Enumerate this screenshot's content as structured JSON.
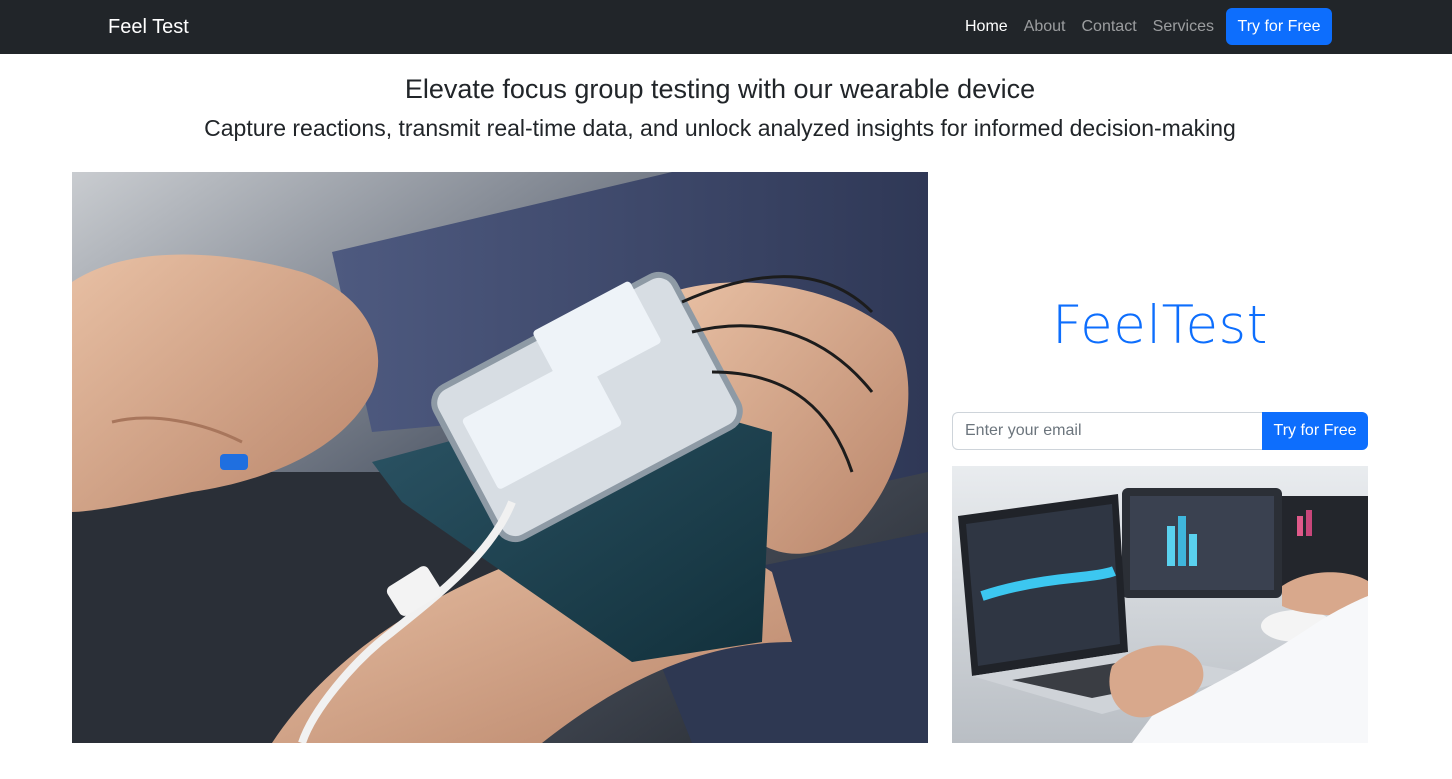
{
  "navbar": {
    "brand": "Feel Test",
    "links": [
      {
        "label": "Home",
        "active": true
      },
      {
        "label": "About",
        "active": false
      },
      {
        "label": "Contact",
        "active": false
      },
      {
        "label": "Services",
        "active": false
      }
    ],
    "cta_label": "Try for Free"
  },
  "hero": {
    "headline": "Elevate focus group testing with our wearable device",
    "subheadline": "Capture reactions, transmit real-time data, and unlock analyzed insights for informed decision-making"
  },
  "sidebar": {
    "logo_text": "FeelTest",
    "email_placeholder": "Enter your email",
    "submit_label": "Try for Free"
  },
  "colors": {
    "navbar_bg": "#212529",
    "accent": "#0d6efd"
  }
}
